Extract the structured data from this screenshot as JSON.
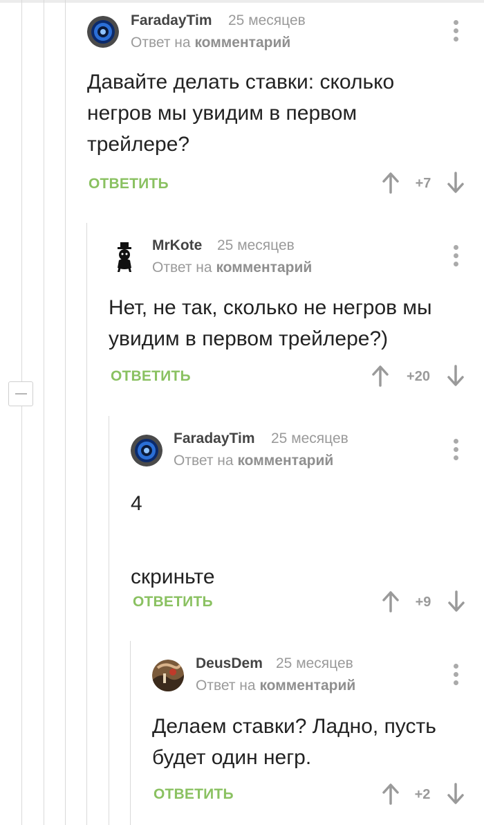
{
  "comments": [
    {
      "author": "FaradayTim",
      "time": "25 месяцев",
      "reply_prefix": "Ответ на",
      "reply_link": "комментарий",
      "text": "Давайте делать ставки: сколько негров мы увидим в первом трейлере?",
      "reply_label": "ОТВЕТИТЬ",
      "score": "+7"
    },
    {
      "author": "MrKote",
      "time": "25 месяцев",
      "reply_prefix": "Ответ на",
      "reply_link": "комментарий",
      "text": "Нет, не так, сколько не негров мы увидим в первом трейлере?)",
      "reply_label": "ОТВЕТИТЬ",
      "score": "+20"
    },
    {
      "author": "FaradayTim",
      "time": "25 месяцев",
      "reply_prefix": "Ответ на",
      "reply_link": "комментарий",
      "text": "4\n\nскриньте",
      "reply_label": "ОТВЕТИТЬ",
      "score": "+9"
    },
    {
      "author": "DeusDem",
      "time": "25 месяцев",
      "reply_prefix": "Ответ на",
      "reply_link": "комментарий",
      "text": "Делаем ставки? Ладно, пусть будет один негр.",
      "reply_label": "ОТВЕТИТЬ",
      "score": "+2"
    }
  ],
  "colors": {
    "reply_button": "#8ac161",
    "meta_text": "#9a9a9a",
    "thread_line": "#d9d9d9"
  }
}
